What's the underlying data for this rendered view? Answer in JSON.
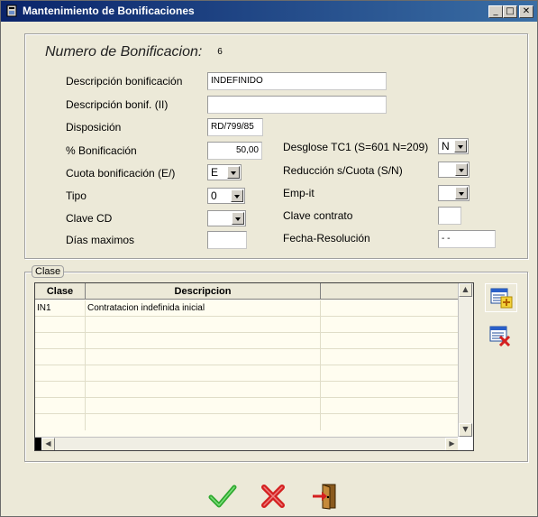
{
  "window": {
    "title": "Mantenimiento de Bonificaciones",
    "min_glyph": "_",
    "max_glyph": "□",
    "close_glyph": "✕"
  },
  "form": {
    "numero_label": "Numero de Bonificacion:",
    "numero_value": "6",
    "descripcion_label": "Descripción  bonificación",
    "descripcion_value": "INDEFINIDO",
    "descripcion2_label": "Descripción bonif. (II)",
    "descripcion2_value": "",
    "disposicion_label": "Disposición",
    "disposicion_value": "RD/799/85",
    "porc_label": "% Bonificación",
    "porc_value": "50,00",
    "cuota_label": "Cuota bonificación (E/)",
    "cuota_value": "E",
    "tipo_label": "Tipo",
    "tipo_value": "0",
    "clave_cd_label": "Clave CD",
    "clave_cd_value": "",
    "dias_label": "Días maximos",
    "dias_value": "",
    "desglose_label": "Desglose  TC1 (S=601 N=209)",
    "desglose_value": "N",
    "reduccion_label": "Reducción s/Cuota (S/N)",
    "reduccion_value": "",
    "empit_label": "Emp-it",
    "empit_value": "",
    "clave_contrato_label": "Clave contrato",
    "clave_contrato_value": "",
    "fecha_label": "Fecha-Resolución",
    "fecha_value": "-  -"
  },
  "clase": {
    "legend": "Clase",
    "columns": [
      "Clase",
      "Descripcion",
      ""
    ],
    "rows": [
      {
        "clase": "IN1",
        "descripcion": "Contratacion indefinida inicial"
      }
    ]
  },
  "icons": {
    "add": "add-row-icon",
    "delete": "delete-row-icon",
    "ok": "checkmark-icon",
    "cancel": "red-x-icon",
    "exit": "exit-door-icon"
  },
  "colors": {
    "titlebar_start": "#0a246a",
    "titlebar_end": "#3a6ea5",
    "ok_green": "#2ea82e",
    "cancel_red": "#d42020",
    "grid_bg": "#fffdf0"
  }
}
